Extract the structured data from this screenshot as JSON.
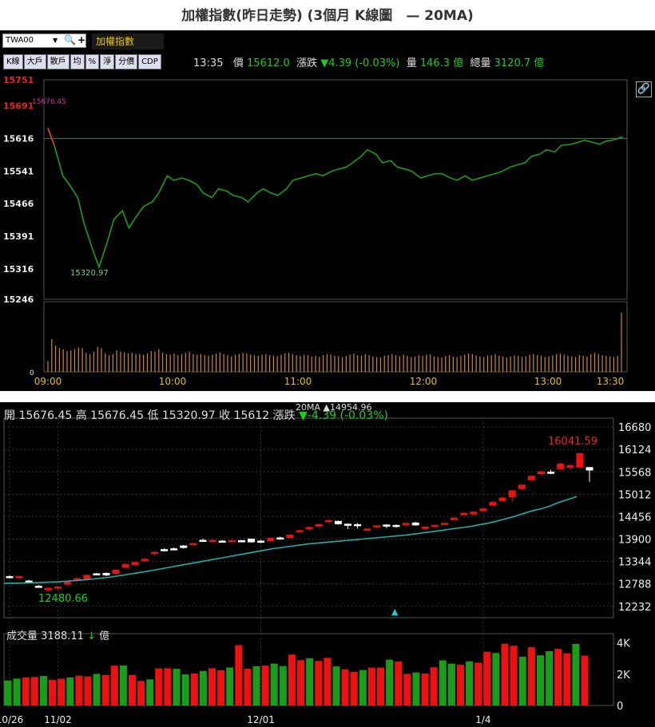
{
  "title": "加權指數(昨日走勢) (3個月 K線圖　— 20MA)",
  "toolbar": {
    "symbol": "TWA00",
    "name": "加權指數",
    "buttons": [
      "K線",
      "大戶",
      "散戶",
      "均",
      "%",
      "淨",
      "分價",
      "CDP"
    ]
  },
  "quote": {
    "time": "13:35",
    "price_label": "價",
    "price": "15612.0",
    "change_label": "漲跌",
    "change": "▼4.39 (-0.03%)",
    "volume_label": "量",
    "volume": "146.3 億",
    "total_label": "總量",
    "total": "3120.7 億"
  },
  "bottom_header": {
    "open_label": "開",
    "open": "15676.45",
    "high_label": "高",
    "high": "15676.45",
    "low_label": "低",
    "low": "15320.97",
    "close_label": "收",
    "close": "15612",
    "change_label": "漲跌",
    "change": "▼-4.39 (-0.03%)",
    "ma_label": "20MA",
    "ma_value": "▲14954.96",
    "vol_label": "成交量",
    "vol_value": "3188.11",
    "vol_arrow": "↓",
    "vol_unit": "億"
  },
  "colors": {
    "up": "#ee1111",
    "down": "#1a9e1a",
    "ma": "#1ab0b0",
    "line": "#1a9e1a",
    "ref": "#2f7f2f"
  },
  "chart_data": [
    {
      "type": "line",
      "title": "intraday",
      "yticks": [
        15751,
        15691,
        15616,
        15541,
        15466,
        15391,
        15316,
        15246
      ],
      "ylim": [
        15246,
        15751
      ],
      "reference": 15616,
      "xticks": [
        "09:00",
        "10:00",
        "11:00",
        "12:00",
        "13:00",
        "13:30"
      ],
      "x_minutes": [
        0,
        3,
        7,
        10,
        14,
        17,
        21,
        24,
        28,
        31,
        35,
        38,
        42,
        45,
        49,
        52,
        56,
        59,
        63,
        66,
        70,
        73,
        77,
        80,
        84,
        87,
        91,
        94,
        98,
        101,
        105,
        108,
        112,
        115,
        119,
        122,
        126,
        129,
        133,
        136,
        140,
        143,
        147,
        150,
        154,
        157,
        161,
        164,
        168,
        171,
        175,
        178,
        182,
        185,
        189,
        192,
        196,
        199,
        203,
        206,
        210,
        213,
        217,
        220,
        224,
        227,
        231,
        234,
        238,
        241,
        245,
        248,
        252,
        255,
        259,
        262,
        265,
        270
      ],
      "y": [
        15640,
        15600,
        15530,
        15510,
        15480,
        15420,
        15360,
        15320,
        15380,
        15430,
        15450,
        15410,
        15440,
        15460,
        15470,
        15490,
        15530,
        15520,
        15525,
        15520,
        15510,
        15490,
        15480,
        15500,
        15495,
        15485,
        15480,
        15470,
        15490,
        15500,
        15490,
        15485,
        15500,
        15520,
        15525,
        15530,
        15535,
        15530,
        15540,
        15545,
        15550,
        15560,
        15575,
        15590,
        15580,
        15560,
        15565,
        15550,
        15545,
        15540,
        15525,
        15530,
        15535,
        15535,
        15525,
        15520,
        15530,
        15520,
        15525,
        15530,
        15535,
        15540,
        15550,
        15555,
        15560,
        15575,
        15580,
        15590,
        15585,
        15600,
        15602,
        15606,
        15612,
        15608,
        15603,
        15610,
        15612,
        15620
      ],
      "annotations": [
        "15676.45",
        "15320.97"
      ],
      "volume_ylabel": "0",
      "volume": [
        18,
        55,
        44,
        40,
        38,
        35,
        36,
        38,
        41,
        40,
        32,
        30,
        34,
        42,
        40,
        31,
        28,
        30,
        36,
        34,
        33,
        31,
        32,
        30,
        30,
        29,
        31,
        35,
        34,
        38,
        32,
        30,
        29,
        31,
        28,
        30,
        32,
        34,
        30,
        29,
        30,
        28,
        27,
        29,
        31,
        33,
        30,
        28,
        26,
        29,
        30,
        32,
        31,
        29,
        28,
        27,
        29,
        30,
        28,
        27,
        26,
        29,
        31,
        32,
        30,
        28,
        27,
        29,
        28,
        26,
        27,
        25,
        28,
        30,
        29,
        27,
        26,
        25,
        27,
        29,
        31,
        28,
        27,
        30,
        28,
        26,
        25,
        24,
        27,
        28,
        30,
        28,
        26,
        29,
        27,
        25,
        26,
        28,
        27,
        29,
        30,
        26,
        25,
        24,
        27,
        28,
        26,
        25,
        27,
        29,
        31,
        30,
        28,
        26,
        25,
        27,
        28,
        30,
        27,
        26,
        24,
        26,
        28,
        27,
        25,
        26,
        29,
        30,
        28,
        27,
        25,
        26,
        28,
        30,
        31,
        29,
        27,
        26,
        25,
        28,
        27,
        26,
        30,
        32,
        30,
        28,
        27,
        26,
        25,
        27,
        100
      ]
    },
    {
      "type": "candlestick",
      "title": "3-month daily K line",
      "yticks": [
        16680,
        16124,
        15568,
        15012,
        14456,
        13900,
        13344,
        12788,
        12232
      ],
      "ylim": [
        11950,
        16900
      ],
      "xticks": [
        {
          "label": "10/26",
          "index": 0
        },
        {
          "label": "11/02",
          "index": 5
        },
        {
          "label": "12/01",
          "index": 26
        },
        {
          "label": "1/4",
          "index": 49
        }
      ],
      "annotations": [
        "16041.59",
        "12480.66"
      ],
      "ohlc": [
        [
          12970,
          13000,
          12930,
          12960
        ],
        [
          12960,
          12990,
          12920,
          12970
        ],
        [
          12860,
          12890,
          12820,
          12850
        ],
        [
          12730,
          12760,
          12700,
          12720
        ],
        [
          12640,
          12700,
          12600,
          12680
        ],
        [
          12680,
          12720,
          12650,
          12710
        ],
        [
          12780,
          12860,
          12750,
          12830
        ],
        [
          12870,
          12940,
          12850,
          12920
        ],
        [
          12920,
          13020,
          12900,
          13000
        ],
        [
          13040,
          13060,
          13000,
          13030
        ],
        [
          13050,
          13070,
          12980,
          13010
        ],
        [
          13050,
          13150,
          13030,
          13130
        ],
        [
          13200,
          13290,
          13180,
          13270
        ],
        [
          13260,
          13340,
          13240,
          13320
        ],
        [
          13360,
          13430,
          13340,
          13400
        ],
        [
          13540,
          13590,
          13510,
          13570
        ],
        [
          13640,
          13670,
          13590,
          13610
        ],
        [
          13660,
          13690,
          13630,
          13650
        ],
        [
          13730,
          13750,
          13660,
          13690
        ],
        [
          13760,
          13810,
          13740,
          13790
        ],
        [
          13870,
          13910,
          13830,
          13850
        ],
        [
          13860,
          13890,
          13830,
          13870
        ],
        [
          13850,
          13880,
          13820,
          13830
        ],
        [
          13840,
          13870,
          13820,
          13860
        ],
        [
          13860,
          13880,
          13830,
          13850
        ],
        [
          13900,
          13910,
          13810,
          13830
        ],
        [
          13850,
          13880,
          13800,
          13830
        ],
        [
          13860,
          13940,
          13840,
          13920
        ],
        [
          13930,
          13960,
          13880,
          13900
        ],
        [
          13940,
          14020,
          13920,
          14000
        ],
        [
          14080,
          14130,
          14060,
          14110
        ],
        [
          14150,
          14210,
          14120,
          14190
        ],
        [
          14220,
          14280,
          14210,
          14260
        ],
        [
          14330,
          14390,
          14300,
          14360
        ],
        [
          14340,
          14360,
          14260,
          14280
        ],
        [
          14270,
          14290,
          14150,
          14250
        ],
        [
          14260,
          14300,
          14160,
          14240
        ],
        [
          14140,
          14180,
          14120,
          14150
        ],
        [
          14200,
          14240,
          14160,
          14230
        ],
        [
          14250,
          14270,
          14170,
          14240
        ],
        [
          14240,
          14260,
          14190,
          14230
        ],
        [
          14250,
          14310,
          14230,
          14290
        ],
        [
          14300,
          14330,
          14230,
          14250
        ],
        [
          14160,
          14220,
          14130,
          14200
        ],
        [
          14220,
          14260,
          14190,
          14240
        ],
        [
          14270,
          14310,
          14250,
          14290
        ],
        [
          14380,
          14440,
          14360,
          14420
        ],
        [
          14500,
          14560,
          14490,
          14540
        ],
        [
          14520,
          14590,
          14500,
          14570
        ],
        [
          14600,
          14670,
          14580,
          14650
        ],
        [
          14740,
          14830,
          14720,
          14810
        ],
        [
          14850,
          14940,
          14830,
          14920
        ],
        [
          14950,
          15120,
          14820,
          15100
        ],
        [
          15150,
          15250,
          15120,
          15240
        ],
        [
          15370,
          15480,
          15350,
          15460
        ],
        [
          15520,
          15590,
          15500,
          15570
        ],
        [
          15560,
          15620,
          15510,
          15530
        ],
        [
          15640,
          15790,
          15620,
          15760
        ],
        [
          15680,
          15760,
          15620,
          15720
        ],
        [
          15680,
          16041,
          15670,
          16020
        ],
        [
          15676,
          15676,
          15321,
          15612
        ]
      ],
      "ma20": [
        12800,
        12805,
        12810,
        12815,
        12820,
        12830,
        12840,
        12855,
        12870,
        12890,
        12910,
        12935,
        12960,
        12995,
        13030,
        13065,
        13100,
        13140,
        13180,
        13220,
        13260,
        13300,
        13340,
        13380,
        13420,
        13460,
        13500,
        13540,
        13580,
        13620,
        13660,
        13690,
        13720,
        13750,
        13780,
        13800,
        13820,
        13840,
        13860,
        13880,
        13900,
        13920,
        13940,
        13960,
        13980,
        14000,
        14030,
        14060,
        14090,
        14120,
        14150,
        14180,
        14210,
        14250,
        14290,
        14340,
        14400,
        14460,
        14530,
        14600,
        14650,
        14720,
        14810,
        14880,
        14955
      ],
      "volume": [
        1600,
        1720,
        1800,
        1820,
        1890,
        1640,
        1710,
        1790,
        1900,
        1860,
        2020,
        1950,
        2550,
        2560,
        1950,
        1570,
        1670,
        2370,
        2380,
        2340,
        1990,
        2050,
        2210,
        2380,
        2250,
        2430,
        3860,
        2350,
        2510,
        2550,
        2680,
        2520,
        3260,
        2900,
        3020,
        2850,
        3050,
        2500,
        2310,
        2150,
        2270,
        2420,
        2420,
        2930,
        2810,
        2020,
        2110,
        2040,
        2440,
        2890,
        2680,
        2600,
        2820,
        2740,
        3440,
        3360,
        3950,
        3820,
        3120,
        3730,
        3210,
        3480,
        3620,
        3340,
        3940,
        3188
      ],
      "volume_ticks": [
        "4K",
        "2K",
        "0"
      ]
    }
  ]
}
